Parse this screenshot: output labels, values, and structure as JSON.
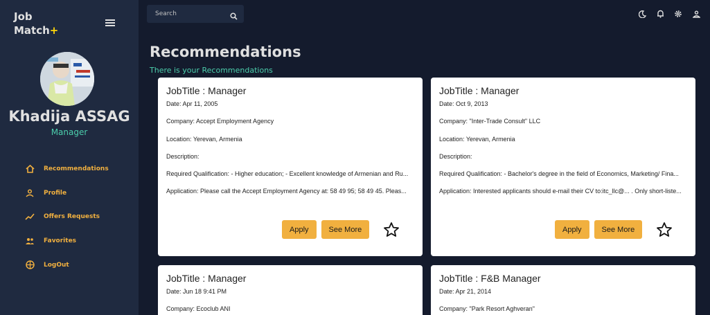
{
  "app": {
    "logo_line1": "Job",
    "logo_line2": "Match",
    "logo_plus": "+"
  },
  "profile": {
    "name": "Khadija ASSAG",
    "role": "Manager"
  },
  "sidebar": {
    "items": [
      {
        "label": "Recommendations",
        "icon": "home-icon"
      },
      {
        "label": "Profile",
        "icon": "person-icon"
      },
      {
        "label": "Offers Requests",
        "icon": "trending-icon"
      },
      {
        "label": "Favorites",
        "icon": "people-icon"
      },
      {
        "label": "LogOut",
        "icon": "logout-icon"
      }
    ]
  },
  "topbar": {
    "search_placeholder": "Search",
    "icons": [
      "moon-icon",
      "bell-icon",
      "settings-icon",
      "person-icon"
    ]
  },
  "header": {
    "title": "Recommendations",
    "subtitle": "There is your Recommendations"
  },
  "colors": {
    "accent": "#f1b03f",
    "teal": "#4cceac",
    "bg": "#141b2d",
    "sidebar": "#1f2a40"
  },
  "cards": [
    {
      "title": "JobTitle : Manager",
      "date": "Date: Apr 11, 2005",
      "company": "Company: Accept Employment Agency",
      "location": "Location: Yerevan, Armenia",
      "description": "Description:",
      "qualification": "Required Qualification: - Higher education; - Excellent knowledge of Armenian and Ru...",
      "application": "Application: Please call the Accept Employment Agency at: 58 49 95; 58 49 45. Pleas...",
      "apply_label": "Apply",
      "more_label": "See More"
    },
    {
      "title": "JobTitle : Manager",
      "date": "Date: Oct 9, 2013",
      "company": "Company: \"Inter-Trade Consult\" LLC",
      "location": "Location: Yerevan, Armenia",
      "description": "Description:",
      "qualification": "Required Qualification: - Bachelor's degree in the field of Economics, Marketing/ Fina...",
      "application": "Application: Interested applicants should e-mail their CV to:itc_llc@... . Only short-liste...",
      "apply_label": "Apply",
      "more_label": "See More"
    },
    {
      "title": "JobTitle : Manager",
      "date": "Date: Jun 18 9:41 PM",
      "company": "Company: Ecoclub ANI"
    },
    {
      "title": "JobTitle : F&B Manager",
      "date": "Date: Apr 21, 2014",
      "company": "Company: \"Park Resort Aghveran\""
    }
  ]
}
